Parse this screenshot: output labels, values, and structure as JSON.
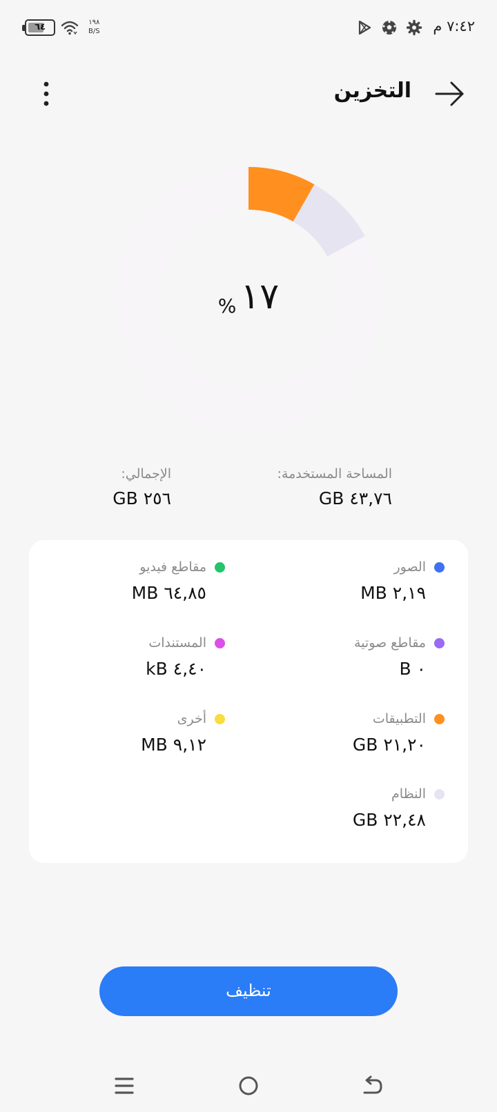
{
  "status_bar": {
    "time": "٧:٤٢ م",
    "battery_level": "٦٤",
    "battery_fraction": 0.64,
    "net_speed_value": "١٩٨",
    "net_speed_unit": "B/S",
    "icons": [
      "play-store-icon",
      "soccer-ball-icon",
      "settings-gear-icon",
      "wifi-icon",
      "battery-icon"
    ]
  },
  "header": {
    "title": "التخزين",
    "back_icon": "arrow-right-icon",
    "more_icon": "more-vertical-icon"
  },
  "donut": {
    "percent_value": "١٧",
    "percent_sign": "%",
    "used_fraction": 0.17,
    "segments": [
      {
        "name": "التطبيقات",
        "fraction": 0.0828,
        "color": "#ff8f1f"
      },
      {
        "name": "النظام",
        "fraction": 0.0878,
        "color": "#e6e4f0"
      }
    ],
    "track_color": "#f8f5f8"
  },
  "summary": {
    "used_label": "المساحة المستخدمة:",
    "used_value": "٤٣,٧٦ GB",
    "total_label": "الإجمالي:",
    "total_value": "٢٥٦ GB"
  },
  "categories": [
    {
      "name": "الصور",
      "size": "٢,١٩ MB",
      "color": "#3e72f0"
    },
    {
      "name": "مقاطع فيديو",
      "size": "٦٤,٨٥ MB",
      "color": "#23c46c"
    },
    {
      "name": "مقاطع صوتية",
      "size": "٠ B",
      "color": "#9a6bf2"
    },
    {
      "name": "المستندات",
      "size": "٤,٤٠ kB",
      "color": "#dc4fe8"
    },
    {
      "name": "التطبيقات",
      "size": "٢١,٢٠ GB",
      "color": "#ff8f1f"
    },
    {
      "name": "أخرى",
      "size": "٩,١٢ MB",
      "color": "#f7dd3e"
    },
    {
      "name": "النظام",
      "size": "٢٢,٤٨ GB",
      "color": "#e6e4f0"
    }
  ],
  "clean_button": {
    "label": "تنظيف",
    "color": "#2a7cf7"
  },
  "nav_bar": {
    "icons": [
      "menu-lines-icon",
      "home-circle-icon",
      "back-arrow-icon"
    ]
  }
}
